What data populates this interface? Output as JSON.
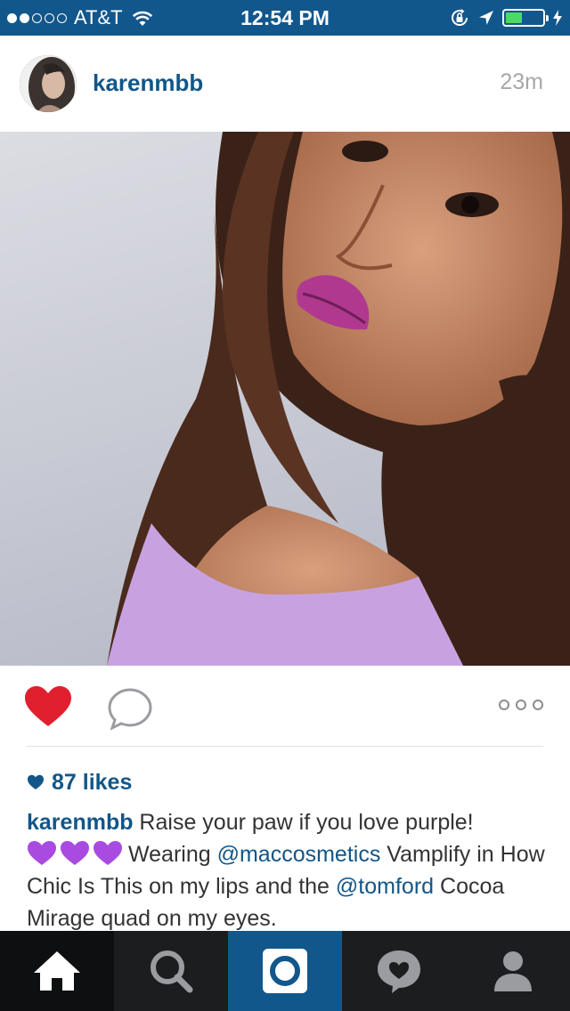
{
  "status_bar": {
    "carrier": "AT&T",
    "time": "12:54 PM",
    "signal_bars_filled": 2,
    "signal_bars_total": 5,
    "battery_level": 0.45,
    "battery_color": "#4cd964",
    "icons": [
      "wifi-icon",
      "orientation-lock-icon",
      "location-arrow-icon",
      "battery-icon",
      "charging-bolt-icon"
    ]
  },
  "post": {
    "username": "karenmbb",
    "time_ago": "23m",
    "likes_text": "87 likes",
    "caption": {
      "username": "karenmbb",
      "text_1": " Raise your paw if you love purple!",
      "emoji": "💜💜💜",
      "text_2": "Wearing ",
      "mention_1": "@maccosmetics",
      "text_3": " Vamplify in How Chic Is This on my lips and the ",
      "mention_2": "@tomford",
      "text_4": " Cocoa Mirage quad on my eyes."
    }
  },
  "actions": {
    "like_icon": "heart-filled-icon",
    "comment_icon": "comment-bubble-icon",
    "more_icon": "more-dots-icon"
  },
  "colors": {
    "brand_blue": "#12578c",
    "link_blue": "#125688",
    "like_red": "#e0202f",
    "tab_bar": "#1c1d1f"
  },
  "tab_bar": {
    "tabs": [
      "home-icon",
      "search-icon",
      "camera-icon",
      "activity-icon",
      "profile-icon"
    ],
    "active": "home"
  }
}
